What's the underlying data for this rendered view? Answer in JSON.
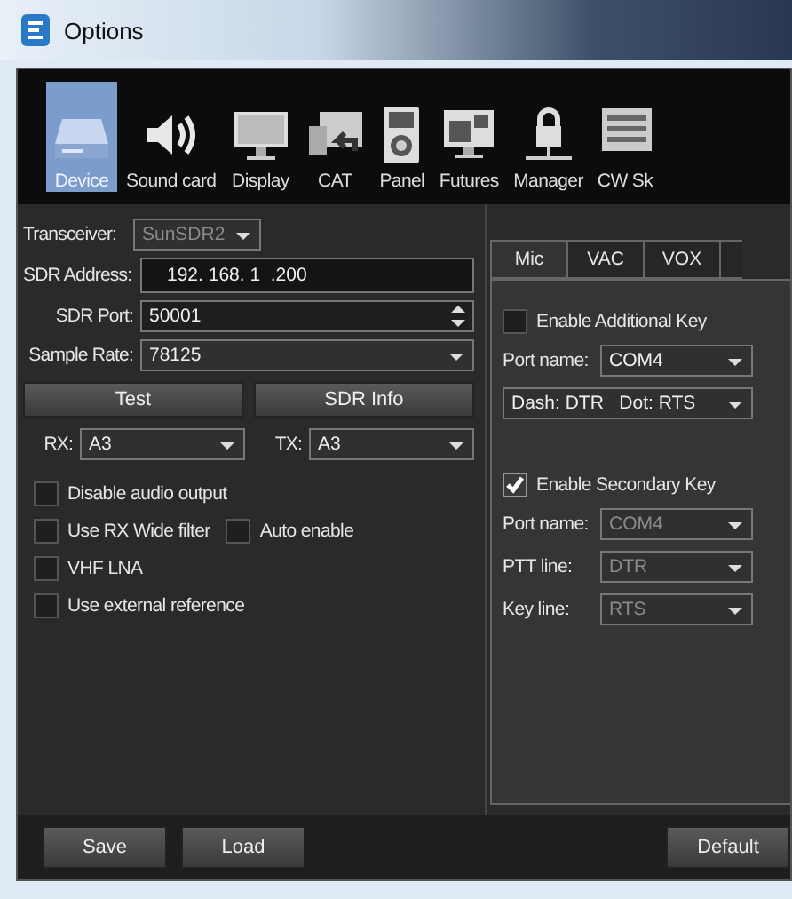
{
  "window": {
    "title": "Options"
  },
  "toolbar": [
    {
      "label": "Device",
      "kind": "drive",
      "selected": true
    },
    {
      "label": "Sound card",
      "kind": "speaker",
      "selected": false
    },
    {
      "label": "Display",
      "kind": "monitor",
      "selected": false
    },
    {
      "label": "CAT",
      "kind": "cat",
      "selected": false
    },
    {
      "label": "Panel",
      "kind": "panel",
      "selected": false
    },
    {
      "label": "Futures",
      "kind": "futures",
      "selected": false
    },
    {
      "label": "Manager",
      "kind": "manager",
      "selected": false
    },
    {
      "label": "CW Sk",
      "kind": "cw",
      "selected": false
    }
  ],
  "device": {
    "transceiver": {
      "label": "Transceiver:",
      "value": "SunSDR2",
      "disabled": true
    },
    "sdr_address": {
      "label": "SDR Address:",
      "value": "192. 168. 1  .200"
    },
    "sdr_port": {
      "label": "SDR Port:",
      "value": "50001"
    },
    "sample_rate": {
      "label": "Sample Rate:",
      "value": "78125"
    },
    "buttons": [
      "Test",
      "SDR Info"
    ],
    "rx": {
      "label": "RX:",
      "value": "A3"
    },
    "tx": {
      "label": "TX:",
      "value": "A3"
    },
    "options": [
      {
        "label": "Disable audio output",
        "checked": false
      },
      {
        "label": "Use RX Wide filter",
        "checked": false,
        "extra": {
          "label": "Auto enable",
          "checked": false
        }
      },
      {
        "label": "VHF LNA",
        "checked": false
      },
      {
        "label": "Use external reference",
        "checked": false
      }
    ]
  },
  "key_tabs": [
    {
      "label": "Mic",
      "selected": true
    },
    {
      "label": "VAC",
      "selected": false
    },
    {
      "label": "VOX",
      "selected": false
    }
  ],
  "additional_key": {
    "label": "Enable Additional Key",
    "checked": false,
    "fields": [
      {
        "label": "Port name:",
        "value": "COM4",
        "disabled": false
      },
      {
        "value": "Dash: DTR   Dot: RTS",
        "disabled": false
      }
    ]
  },
  "secondary_key": {
    "label": "Enable Secondary Key",
    "checked": true,
    "fields": [
      {
        "label": "Port name:",
        "value": "COM4",
        "disabled": true
      },
      {
        "label": "PTT line:",
        "value": "DTR",
        "disabled": true
      },
      {
        "label": "Key line:",
        "value": "RTS",
        "disabled": true
      }
    ]
  },
  "footer": {
    "left_buttons": [
      "Save",
      "Load"
    ],
    "right_buttons": [
      "Default"
    ]
  }
}
